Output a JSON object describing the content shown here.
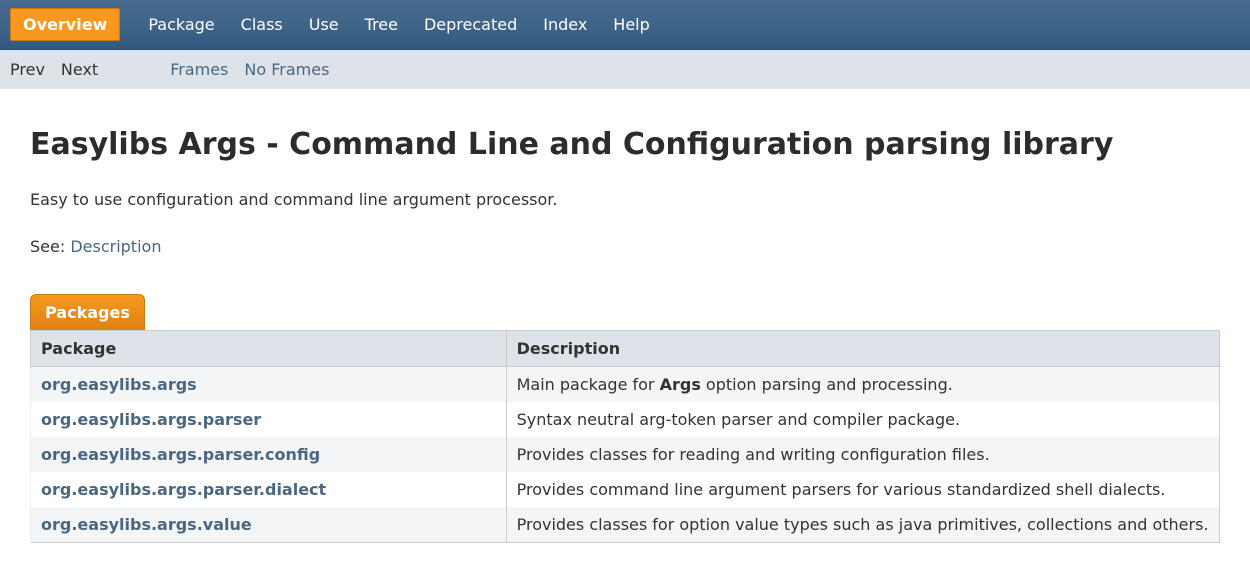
{
  "topnav": {
    "overview": "Overview",
    "package": "Package",
    "class": "Class",
    "use": "Use",
    "tree": "Tree",
    "deprecated": "Deprecated",
    "index": "Index",
    "help": "Help"
  },
  "subnav": {
    "prev": "Prev",
    "next": "Next",
    "frames": "Frames",
    "noframes": "No Frames"
  },
  "title": "Easylibs Args - Command Line and Configuration parsing library",
  "intro": "Easy to use configuration and command line argument processor.",
  "see_label": "See: ",
  "see_link": "Description",
  "table_caption": "Packages",
  "columns": {
    "package": "Package",
    "description": "Description"
  },
  "rows": [
    {
      "pkg": "org.easylibs.args",
      "desc_pre": "Main package for ",
      "desc_bold": "Args",
      "desc_post": " option parsing and processing."
    },
    {
      "pkg": "org.easylibs.args.parser",
      "desc_pre": "Syntax neutral arg-token parser and compiler package.",
      "desc_bold": "",
      "desc_post": ""
    },
    {
      "pkg": "org.easylibs.args.parser.config",
      "desc_pre": "Provides classes for reading and writing configuration files.",
      "desc_bold": "",
      "desc_post": ""
    },
    {
      "pkg": "org.easylibs.args.parser.dialect",
      "desc_pre": "Provides command line argument parsers for various standardized shell dialects.",
      "desc_bold": "",
      "desc_post": ""
    },
    {
      "pkg": "org.easylibs.args.value",
      "desc_pre": "Provides classes for option value types such as java primitives, collections and others.",
      "desc_bold": "",
      "desc_post": ""
    }
  ]
}
